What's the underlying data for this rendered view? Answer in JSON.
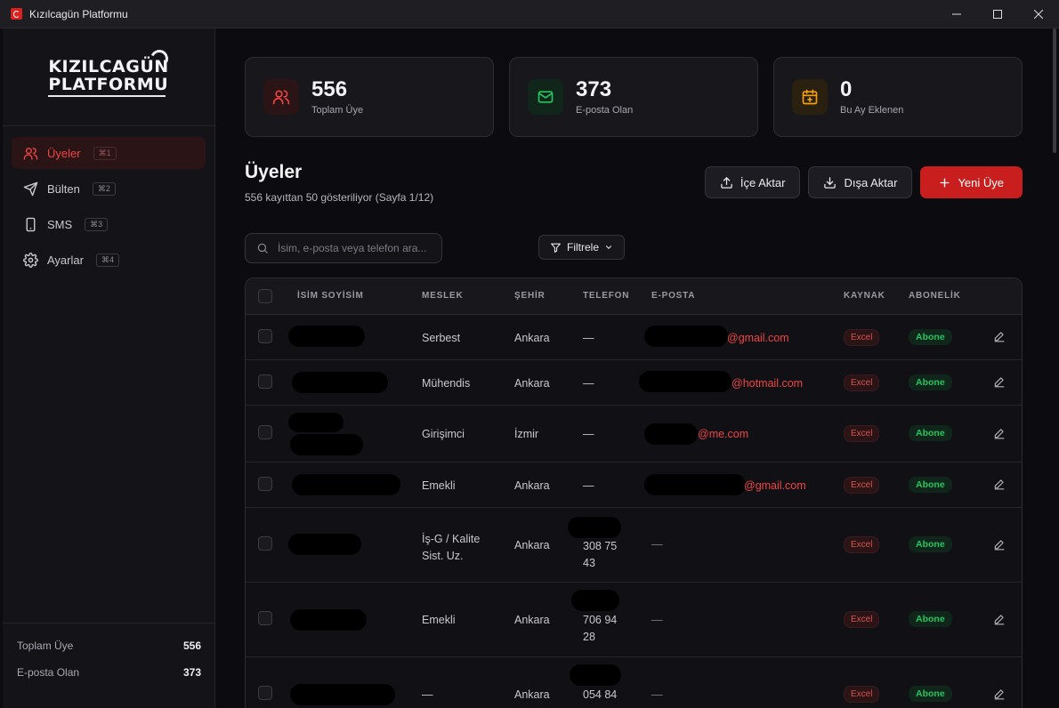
{
  "window": {
    "title": "Kızılcagün Platformu"
  },
  "logo": {
    "line1": "KIZILCAGÜN",
    "line2": "PLATFORMU"
  },
  "sidebar": {
    "items": [
      {
        "label": "Üyeler",
        "shortcut": "⌘1",
        "icon": "users-icon",
        "active": true
      },
      {
        "label": "Bülten",
        "shortcut": "⌘2",
        "icon": "send-icon",
        "active": false
      },
      {
        "label": "SMS",
        "shortcut": "⌘3",
        "icon": "phone-icon",
        "active": false
      },
      {
        "label": "Ayarlar",
        "shortcut": "⌘4",
        "icon": "gear-icon",
        "active": false
      }
    ],
    "stats": [
      {
        "label": "Toplam Üye",
        "value": "556"
      },
      {
        "label": "E-posta Olan",
        "value": "373"
      }
    ]
  },
  "cards": [
    {
      "value": "556",
      "label": "Toplam Üye",
      "icon": "users-icon",
      "color": "#ef4444"
    },
    {
      "value": "373",
      "label": "E-posta Olan",
      "icon": "mail-icon",
      "color": "#22c55e"
    },
    {
      "value": "0",
      "label": "Bu Ay Eklenen",
      "icon": "calendar-plus-icon",
      "color": "#f59e0b"
    }
  ],
  "page": {
    "title": "Üyeler",
    "subtitle": "556 kayıttan 50 gösteriliyor (Sayfa 1/12)"
  },
  "actions": {
    "import_label": "İçe Aktar",
    "export_label": "Dışa Aktar",
    "new_label": "Yeni Üye"
  },
  "search": {
    "placeholder": "İsim, e-posta veya telefon ara..."
  },
  "filter": {
    "label": "Filtrele"
  },
  "table": {
    "headers": {
      "name": "İSİM SOYİSİM",
      "job": "MESLEK",
      "city": "ŞEHİR",
      "phone": "TELEFON",
      "email": "E-POSTA",
      "source": "KAYNAK",
      "subscription": "ABONELİK"
    },
    "rows": [
      {
        "job": "Serbest",
        "city": "Ankara",
        "phone": "—",
        "email": "@gmail.com",
        "source": "Excel",
        "subscription": "Abone"
      },
      {
        "job": "Mühendis",
        "city": "Ankara",
        "phone": "—",
        "email": "@hotmail.com",
        "source": "Excel",
        "subscription": "Abone"
      },
      {
        "job": "Girişimci",
        "city": "İzmir",
        "phone": "—",
        "email": "@me.com",
        "source": "Excel",
        "subscription": "Abone"
      },
      {
        "job": "Emekli",
        "city": "Ankara",
        "phone": "—",
        "email": "@gmail.com",
        "source": "Excel",
        "subscription": "Abone"
      },
      {
        "job": "İş-G / Kalite Sist. Uz.",
        "city": "Ankara",
        "phone": "308 75 43",
        "email": "—",
        "source": "Excel",
        "subscription": "Abone"
      },
      {
        "job": "Emekli",
        "city": "Ankara",
        "phone": "706 94 28",
        "email": "—",
        "source": "Excel",
        "subscription": "Abone"
      },
      {
        "job": "—",
        "city": "Ankara",
        "phone": "054 84",
        "email": "—",
        "source": "Excel",
        "subscription": "Abone"
      }
    ]
  }
}
